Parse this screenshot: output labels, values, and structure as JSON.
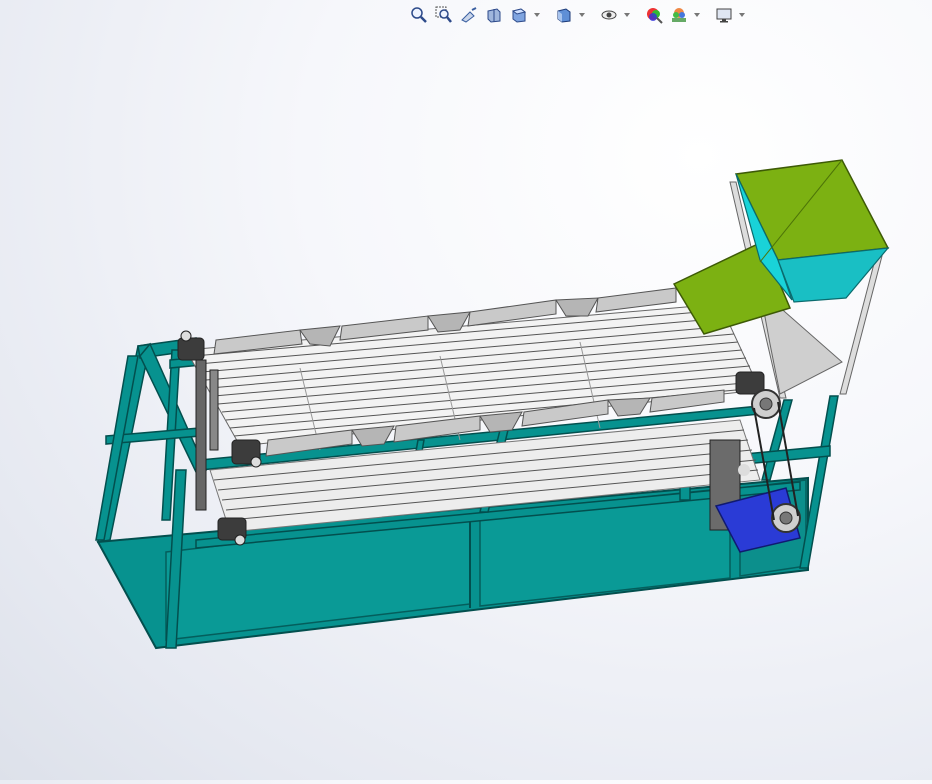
{
  "window": {
    "title": ""
  },
  "toolbar": {
    "items": [
      {
        "id": "zoom-to-fit",
        "icon": "zoom-fit-icon",
        "dropdown": false
      },
      {
        "id": "zoom-to-area",
        "icon": "zoom-area-icon",
        "dropdown": false
      },
      {
        "id": "previous-view",
        "icon": "previous-view-icon",
        "dropdown": false
      },
      {
        "id": "section-view",
        "icon": "section-view-icon",
        "dropdown": false
      },
      {
        "id": "view-orientation",
        "icon": "view-orientation-icon",
        "dropdown": true
      },
      {
        "id": "display-style",
        "icon": "display-style-icon",
        "dropdown": true
      },
      {
        "id": "hide-show-items",
        "icon": "hide-show-eye-icon",
        "dropdown": true
      },
      {
        "id": "edit-appearance",
        "icon": "edit-appearance-icon",
        "dropdown": false
      },
      {
        "id": "apply-scene",
        "icon": "apply-scene-icon",
        "dropdown": true
      },
      {
        "id": "view-settings",
        "icon": "monitor-icon",
        "dropdown": true
      }
    ]
  },
  "model": {
    "frame_color": "#07928f",
    "frame_dark": "#046b69",
    "hopper_color": "#7cb112",
    "hopper_side": "#19d3d8",
    "tray_color": "#c9c9c9",
    "roller_color": "#e8e8e8",
    "motor_color": "#2a3bd6"
  }
}
